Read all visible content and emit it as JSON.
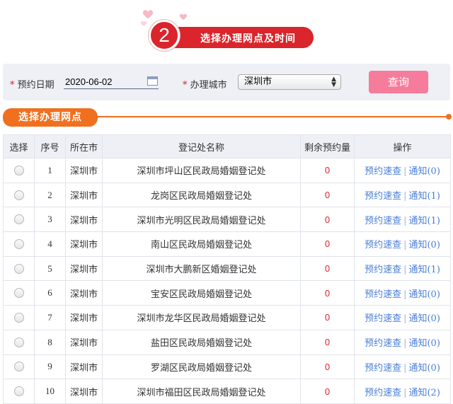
{
  "step": {
    "number": "2",
    "title": "选择办理网点及时间"
  },
  "form": {
    "date_label": "预约日期",
    "date_value": "2020-06-02",
    "city_label": "办理城市",
    "city_value": "深圳市",
    "required_mark": "*",
    "query_button": "查询"
  },
  "section": {
    "title": "选择办理网点"
  },
  "table": {
    "headers": [
      "选择",
      "序号",
      "所在市",
      "登记处名称",
      "剩余预约量",
      "操作"
    ],
    "action_label": "预约速查",
    "action_separator": "|",
    "rows": [
      {
        "no": "1",
        "city": "深圳市",
        "name": "深圳市坪山区民政局婚姻登记处",
        "remain": "0",
        "notice": "通知(0)"
      },
      {
        "no": "2",
        "city": "深圳市",
        "name": "龙岗区民政局婚姻登记处",
        "remain": "0",
        "notice": "通知(1)"
      },
      {
        "no": "3",
        "city": "深圳市",
        "name": "深圳市光明区民政局婚姻登记处",
        "remain": "0",
        "notice": "通知(1)"
      },
      {
        "no": "4",
        "city": "深圳市",
        "name": "南山区民政局婚姻登记处",
        "remain": "0",
        "notice": "通知(0)"
      },
      {
        "no": "5",
        "city": "深圳市",
        "name": "深圳市大鹏新区婚姻登记处",
        "remain": "0",
        "notice": "通知(1)"
      },
      {
        "no": "6",
        "city": "深圳市",
        "name": "宝安区民政局婚姻登记处",
        "remain": "0",
        "notice": "通知(0)"
      },
      {
        "no": "7",
        "city": "深圳市",
        "name": "深圳市龙华区民政局婚姻登记处",
        "remain": "0",
        "notice": "通知(0)"
      },
      {
        "no": "8",
        "city": "深圳市",
        "name": "盐田区民政局婚姻登记处",
        "remain": "0",
        "notice": "通知(0)"
      },
      {
        "no": "9",
        "city": "深圳市",
        "name": "罗湖区民政局婚姻登记处",
        "remain": "0",
        "notice": "通知(0)"
      },
      {
        "no": "10",
        "city": "深圳市",
        "name": "深圳市福田区民政局婚姻登记处",
        "remain": "0",
        "notice": "通知(2)"
      }
    ]
  },
  "colors": {
    "brand_red": "#d9252b",
    "accent_orange": "#f0701f",
    "button_pink": "#f57c9a",
    "link_blue": "#4a7fd8"
  }
}
